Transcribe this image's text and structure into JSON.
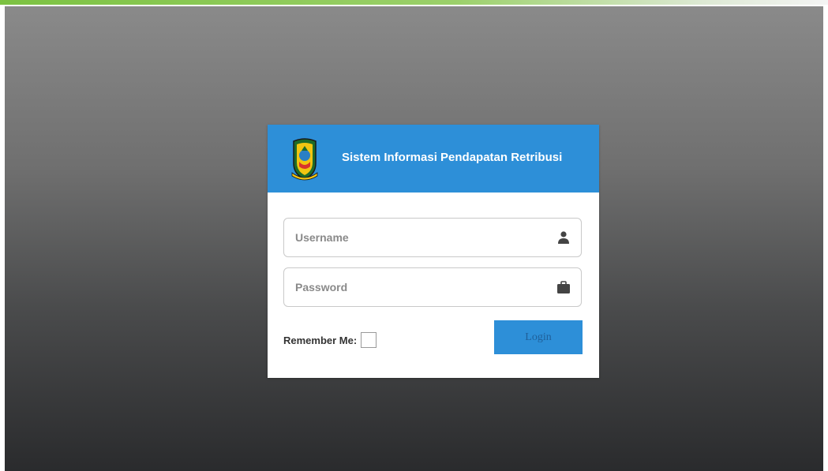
{
  "header": {
    "title": "Sistem Informasi Pendapatan Retribusi",
    "logo_icon": "regional-emblem-icon"
  },
  "form": {
    "username": {
      "placeholder": "Username",
      "value": "",
      "icon": "user-icon"
    },
    "password": {
      "placeholder": "Password",
      "value": "",
      "icon": "briefcase-icon"
    },
    "remember_label": "Remember Me:",
    "remember_checked": false,
    "login_label": "Login"
  },
  "colors": {
    "accent": "#2d8fd8",
    "top_bar": "#7cc242",
    "background_top": "#8a8a8a",
    "background_bottom": "#2a2b2d"
  }
}
